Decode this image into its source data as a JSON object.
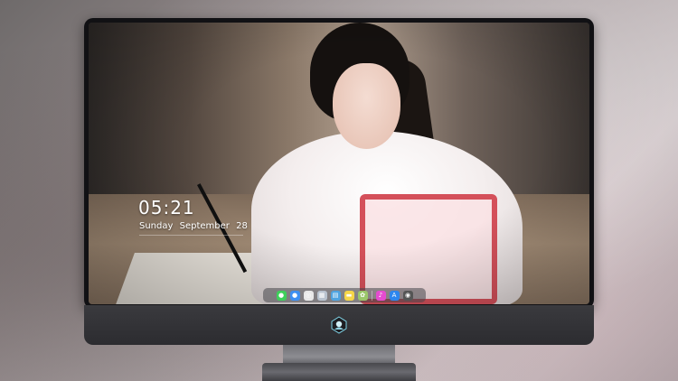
{
  "lock_screen": {
    "time": "05:21",
    "weekday": "Sunday",
    "month": "September",
    "day": "28"
  },
  "dock": {
    "items": [
      {
        "name": "messages-icon",
        "glyph": "●",
        "color": "#3ecf5a"
      },
      {
        "name": "finder-icon",
        "glyph": "●",
        "color": "#3d8ff2"
      },
      {
        "name": "safari-icon",
        "glyph": "◎",
        "color": "#e8e8e8"
      },
      {
        "name": "preview-icon",
        "glyph": "▦",
        "color": "#b9c3cf"
      },
      {
        "name": "clapper-icon",
        "glyph": "▤",
        "color": "#4fa3e0"
      },
      {
        "name": "notes-icon",
        "glyph": "▬",
        "color": "#f5d548"
      },
      {
        "name": "photos-icon",
        "glyph": "✿",
        "color": "#9bc76a"
      },
      {
        "name": "music-icon",
        "glyph": "♪",
        "color": "#e54bd0"
      },
      {
        "name": "app-store-icon",
        "glyph": "A",
        "color": "#2d86ee"
      },
      {
        "name": "camera-icon",
        "glyph": "◉",
        "color": "#555555"
      }
    ]
  }
}
